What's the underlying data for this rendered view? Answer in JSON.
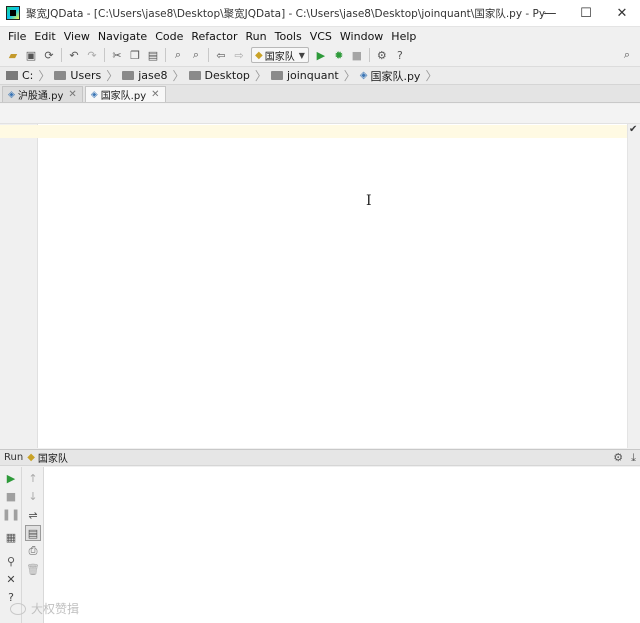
{
  "window": {
    "title": "聚宽JQData - [C:\\Users\\jase8\\Desktop\\聚宽JQData] - C:\\Users\\jase8\\Desktop\\joinquant\\国家队.py - PyCharm Comm...",
    "controls": {
      "minimize": "—",
      "maximize": "☐",
      "close": "✕"
    }
  },
  "menu": {
    "items": [
      {
        "label": "File"
      },
      {
        "label": "Edit"
      },
      {
        "label": "View"
      },
      {
        "label": "Navigate"
      },
      {
        "label": "Code"
      },
      {
        "label": "Refactor"
      },
      {
        "label": "Run"
      },
      {
        "label": "Tools"
      },
      {
        "label": "VCS"
      },
      {
        "label": "Window"
      },
      {
        "label": "Help"
      }
    ]
  },
  "toolbar": {
    "run_config": "国家队"
  },
  "breadcrumb": {
    "items": [
      "C:",
      "Users",
      "jase8",
      "Desktop",
      "joinquant",
      "国家队.py"
    ]
  },
  "tabs": [
    {
      "label": "沪股通.py",
      "active": false
    },
    {
      "label": "国家队.py",
      "active": true
    }
  ],
  "run_panel": {
    "label": "Run",
    "config": "国家队"
  },
  "watermark": {
    "text": "大权赞揖"
  },
  "colors": {
    "caret_line": "#fffae3",
    "run_green": "#2e9a3a",
    "python_blue": "#3b76b6"
  }
}
